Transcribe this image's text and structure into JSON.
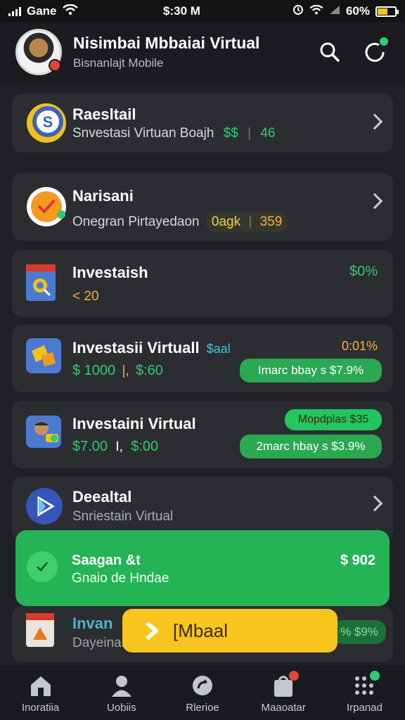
{
  "status": {
    "carrier": "Gane",
    "time": "$:30 M",
    "battery": "60%"
  },
  "header": {
    "title": "Nisimbai Mbbaiai Virtual",
    "subtitle": "Bisnanlajt Mobile"
  },
  "items": [
    {
      "title": "Raesltail",
      "subtitle": "Snvestasi Virtuan Boajh",
      "value1": "$$",
      "value2": "46"
    },
    {
      "title": "Narisani",
      "subtitle": "Onegran Pirtayedaon",
      "tag": "0agk",
      "value": "359"
    },
    {
      "title": "Investaish",
      "sub_value": "< 20",
      "right_value": "$0%"
    },
    {
      "title": "Investasii Virtuall",
      "title_tag": "$aal",
      "right_value": "0:01%",
      "price": "$ 1000",
      "price2": "$:60",
      "pill": "Imarc bbay s $7.9%"
    },
    {
      "title": "Investaini Virtual",
      "badge": "Mopdplas $35",
      "price": "$7.00",
      "price2": "$:00",
      "pill": "2marc hbay s $3.9%"
    },
    {
      "title": "Deealtal",
      "subtitle": "Snriestain Virtual"
    },
    {
      "title": "Invan",
      "subtitle": "Dayeinar",
      "right_value": "% $9%"
    }
  ],
  "promo": {
    "title": "Saagan &t",
    "subtitle": "Gnaio de Hndae",
    "value": "$ 902"
  },
  "cta": {
    "label": "[Mbaal"
  },
  "nav": [
    {
      "label": "Inoratiia",
      "icon": "home-icon"
    },
    {
      "label": "Uobiis",
      "icon": "user-icon"
    },
    {
      "label": "Rlerioe",
      "icon": "refresh-icon"
    },
    {
      "label": "Maaoatar",
      "icon": "bag-icon"
    },
    {
      "label": "Irpanad",
      "icon": "grid-icon"
    }
  ],
  "colors": {
    "accent_green": "#2ecc71",
    "accent_yellow": "#f7c51c",
    "card": "#2b2d31",
    "bg": "#1f2124"
  }
}
